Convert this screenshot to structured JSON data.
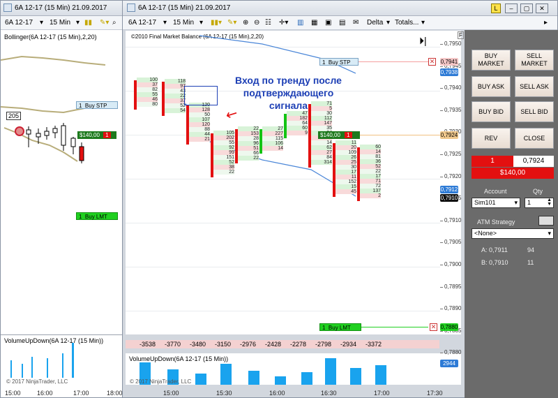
{
  "left_window": {
    "instrument": "6A 12-17",
    "period": "15 Min",
    "title": "6A 12-17 (15 Min)  21.09.2017",
    "indicator_label": "Bollinger(6A 12-17 (15 Min),2,20)",
    "buy_stp_qty": "1",
    "buy_stp_label": "Buy STP",
    "position_pnl": "$140,00",
    "position_qty": "1",
    "buy_lmt_qty": "1",
    "buy_lmt_label": "Buy LMT",
    "bar_count_label": "205",
    "volume_label": "VolumeUpDown(6A 12-17 (15 Min))",
    "footer": "© 2017 NinjaTrader, LLC",
    "x_ticks": [
      "15:00",
      "16:00",
      "17:00",
      "18:00"
    ]
  },
  "main_window": {
    "title": "6A 12-17 (15 Min)  21.09.2017",
    "toolbar": {
      "instrument": "6A 12-17",
      "period": "15 Min",
      "delta": "Delta",
      "totals": "Totals..."
    },
    "indicator_label": "©2010 Final Market Balance   (6A 12-17 (15 Min),2,20)",
    "annotation": "Вход по тренду после подтверждающего сигнала",
    "y_labels": [
      "0,7950",
      "0,7945",
      "0,7940",
      "0,7935",
      "0,7930",
      "0,7925",
      "0,7920",
      "0,7915",
      "0,7910",
      "0,7905",
      "0,7900",
      "0,7895",
      "0,7890",
      "0,7885",
      "0,7880"
    ],
    "price_badges": {
      "buy_stp": "0,7941",
      "ask": "0,7938",
      "last": "0,7924",
      "bid_low": "0,7912",
      "current": "0,7910",
      "buy_lmt": "0,7880"
    },
    "buy_stp_qty": "1",
    "buy_stp_label": "Buy STP",
    "position_pnl": "$140,00",
    "position_qty": "1",
    "buy_lmt_qty": "1",
    "buy_lmt_label": "Buy LMT",
    "delta_values": [
      "-3538",
      "-3770",
      "-3480",
      "-3150",
      "-2976",
      "-2428",
      "-2278",
      "-2798",
      "-2934",
      "-3372"
    ],
    "volume_label": "VolumeUpDown(6A 12-17 (15 Min))",
    "volume_badge": "2944",
    "footer": "© 2017 NinjaTrader, LLC",
    "x_ticks": [
      "15:00",
      "15:30",
      "16:00",
      "16:30",
      "17:00",
      "17:30"
    ],
    "footprint_columns": [
      [
        "100",
        "37",
        "82",
        "55",
        "46",
        "80"
      ],
      [
        "118",
        "97",
        "43",
        "22",
        "37",
        "52",
        "54"
      ],
      [
        "120",
        "128",
        "50",
        "107",
        "120",
        "88",
        "44",
        "21"
      ],
      [
        "105",
        "202",
        "55",
        "92",
        "99",
        "151",
        "52",
        "38",
        "22"
      ],
      [
        "22",
        "153",
        "28",
        "96",
        "51",
        "66",
        "22"
      ],
      [
        "27",
        "227",
        "115",
        "106",
        "14"
      ],
      [
        "47",
        "182",
        "64",
        "60",
        "9"
      ],
      [
        "71",
        "5",
        "30",
        "112",
        "147",
        "35",
        "24",
        "19",
        "14",
        "62",
        "27",
        "84",
        "314"
      ],
      [
        "11",
        "20",
        "109",
        "26",
        "25",
        "30",
        "17",
        "11",
        "152",
        "15",
        "45"
      ],
      [
        "60",
        "14",
        "81",
        "36",
        "52",
        "22",
        "17",
        "71",
        "72",
        "137",
        "2"
      ]
    ]
  },
  "order_panel": {
    "buy_market": "BUY MARKET",
    "sell_market": "SELL MARKET",
    "buy_ask": "BUY ASK",
    "sell_ask": "SELL ASK",
    "buy_bid": "BUY BID",
    "sell_bid": "SELL BID",
    "rev": "REV",
    "close": "CLOSE",
    "position_qty": "1",
    "position_price": "0,7924",
    "pnl": "$140,00",
    "account_label": "Account",
    "qty_label": "Qty",
    "account_value": "Sim101",
    "qty_value": "1",
    "atm_label": "ATM Strategy",
    "atm_value": "<None>",
    "ask_label": "A: 0,7911",
    "ask_size": "94",
    "bid_label": "B: 0,7910",
    "bid_size": "11"
  },
  "colors": {
    "accent_red": "#e31010",
    "accent_green": "#14c414",
    "badge_blue": "#2e7bd6",
    "volume_blue": "#19a3ee"
  }
}
